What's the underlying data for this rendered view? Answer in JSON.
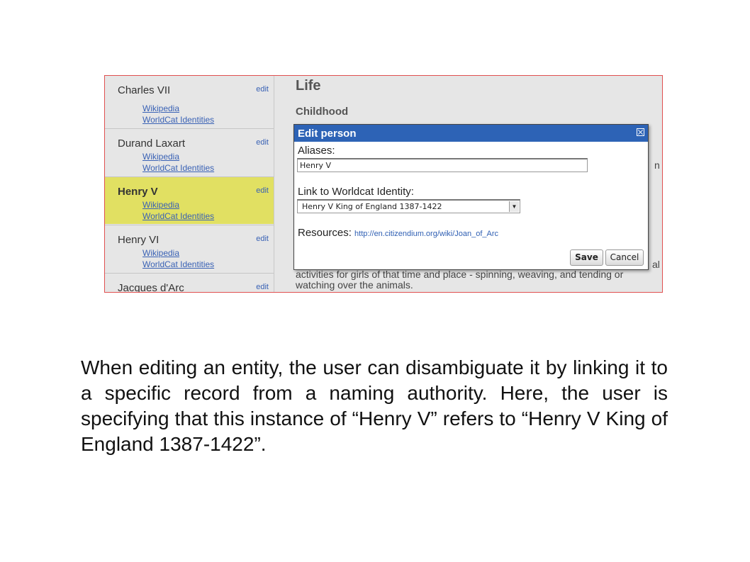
{
  "sidebar": {
    "people": [
      {
        "name": "Charles VII",
        "edit": "edit",
        "links": [
          "Wikipedia",
          "WorldCat Identities"
        ],
        "selected": false
      },
      {
        "name": "Durand Laxart",
        "edit": "edit",
        "links": [
          "Wikipedia",
          "WorldCat Identities"
        ],
        "selected": false
      },
      {
        "name": "Henry V",
        "edit": "edit",
        "links": [
          "Wikipedia",
          "WorldCat Identities"
        ],
        "selected": true
      },
      {
        "name": "Henry VI",
        "edit": "edit",
        "links": [
          "Wikipedia",
          "WorldCat Identities"
        ],
        "selected": false
      },
      {
        "name": "Jacques d'Arc",
        "edit": "edit",
        "links": [],
        "selected": false
      }
    ]
  },
  "main": {
    "section_title": "Life",
    "subsection_title": "Childhood",
    "peek_right_1": "n",
    "peek_right_2": "al",
    "body_text": "activities for girls of that time and place - spinning, weaving, and tending or watching over the animals."
  },
  "dialog": {
    "title": "Edit person",
    "aliases_label": "Aliases:",
    "aliases_value": "Henry V",
    "worldcat_label": "Link to Worldcat Identity:",
    "worldcat_selected": "Henry V King of England 1387-1422",
    "resources_label": "Resources:",
    "resources_url": "http://en.citizendium.org/wiki/Joan_of_Arc",
    "save_label": "Save",
    "cancel_label": "Cancel"
  },
  "caption": "When editing an entity, the user can disambiguate it by linking it to a specific record from a naming authority. Here, the user is specifying that this instance of “Henry V” refers to “Henry V King of England 1387-1422”.",
  "colors": {
    "selected_row": "#e1e062",
    "link": "#3a62b5",
    "dialog_titlebar": "#2d63b6",
    "frame_border": "#e05050"
  }
}
